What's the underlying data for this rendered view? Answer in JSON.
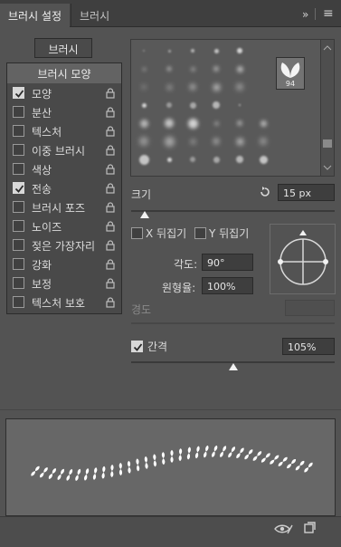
{
  "tabs": {
    "active": "브러시 설정",
    "inactive": "브러시"
  },
  "controls": {
    "collapse": "»",
    "menu": "≡"
  },
  "brushes_button": "브러시",
  "left_panel": {
    "header": "브러시 모양",
    "items": [
      {
        "label": "모양",
        "checked": true
      },
      {
        "label": "분산",
        "checked": false
      },
      {
        "label": "텍스처",
        "checked": false
      },
      {
        "label": "이중 브러시",
        "checked": false
      },
      {
        "label": "색상",
        "checked": false
      },
      {
        "label": "전송",
        "checked": true
      },
      {
        "label": "브러시 포즈",
        "checked": false
      },
      {
        "label": "노이즈",
        "checked": false
      },
      {
        "label": "젖은 가장자리",
        "checked": false
      },
      {
        "label": "강화",
        "checked": false
      },
      {
        "label": "보정",
        "checked": false
      },
      {
        "label": "텍스처 보호",
        "checked": false
      }
    ]
  },
  "preset": {
    "selected_size": "94"
  },
  "size": {
    "label": "크기",
    "value": "15 px"
  },
  "flip_x": {
    "label": "X 뒤집기",
    "checked": false
  },
  "flip_y": {
    "label": "Y 뒤집기",
    "checked": false
  },
  "angle": {
    "label": "각도:",
    "value": "90°"
  },
  "roundness": {
    "label": "원형율:",
    "value": "100%"
  },
  "hardness": {
    "label": "경도",
    "value": ""
  },
  "spacing": {
    "label": "간격",
    "checked": true,
    "value": "105%"
  },
  "colors": {
    "panel_bg": "#535353",
    "header": "#3f3f3f",
    "swatch_white": "#e8e8e8"
  }
}
